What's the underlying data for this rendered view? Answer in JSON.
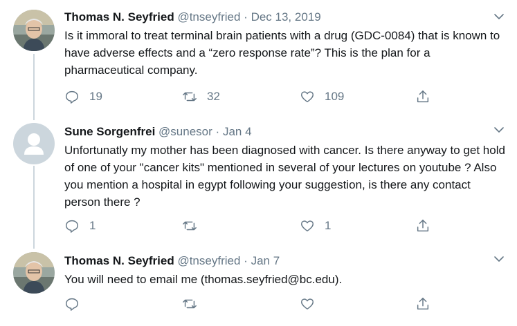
{
  "tweets": [
    {
      "name": "Thomas N. Seyfried",
      "handle": "@tnseyfried",
      "sep": "·",
      "date": "Dec 13, 2019",
      "text": "Is it immoral to treat terminal brain patients with a drug (GDC-0084) that is known to have adverse effects and a “zero response rate”?  This is the plan for a pharmaceutical company.",
      "replies": "19",
      "retweets": "32",
      "likes": "109"
    },
    {
      "name": "Sune Sorgenfrei",
      "handle": "@sunesor",
      "sep": "·",
      "date": "Jan 4",
      "text": "Unfortunatly my mother has been diagnosed with cancer. Is there anyway to get hold of one of your \"cancer kits\" mentioned in several of your lectures on youtube ? Also you mention a hospital in egypt following your suggestion, is there any contact person there ?",
      "replies": "1",
      "retweets": "",
      "likes": "1"
    },
    {
      "name": "Thomas N. Seyfried",
      "handle": "@tnseyfried",
      "sep": "·",
      "date": "Jan 7",
      "text": "You will need to email me (thomas.seyfried@bc.edu).",
      "replies": "",
      "retweets": "",
      "likes": ""
    }
  ],
  "colors": {
    "text": "#14171a",
    "muted": "#657786",
    "thread_line": "#ccd6dd",
    "default_avatar": "#ccd6dd"
  },
  "icons": [
    "reply-icon",
    "retweet-icon",
    "like-icon",
    "share-icon",
    "chevron-down-icon"
  ]
}
